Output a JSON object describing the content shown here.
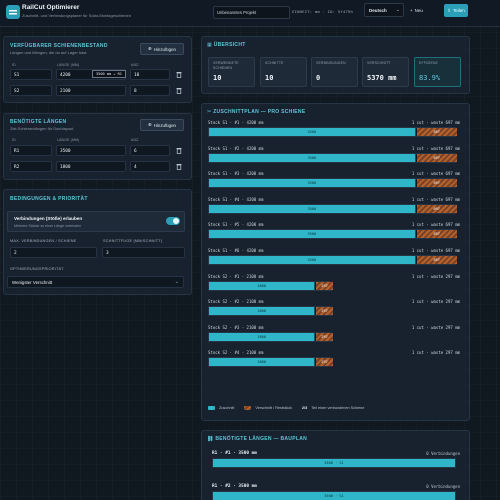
{
  "header": {
    "app_title": "RailCut Optimierer",
    "app_subtitle": "Zuschnitt- und Verbindungsplaner für Solar-Montageschienen",
    "project_name": "Unbenanntes Projekt",
    "unit_info": "EINHEIT: mm · ID: 5f479h",
    "language": "Deutsch",
    "new_label": "Neu",
    "share_label": "Teilen",
    "accent": "#2a9fb8"
  },
  "stock": {
    "title": "VERFÜGBARER SCHIENENBESTAND",
    "subtitle": "Längen und Mengen, die du auf Lager hast",
    "add_label": "Hinzufügen",
    "headers": [
      "ID",
      "LÄNGE (MM)",
      "ANZ."
    ],
    "rows": [
      {
        "id": "S1",
        "length": "4200",
        "qty": "10"
      },
      {
        "id": "S2",
        "length": "2100",
        "qty": "8"
      }
    ],
    "tooltip": "3500 mm → R1"
  },
  "required": {
    "title": "BENÖTIGTE LÄNGEN",
    "subtitle": "Ziel-Schienenlängen für Dachlayout",
    "add_label": "Hinzufügen",
    "headers": [
      "ID",
      "LÄNGE (MM)",
      "ANZ."
    ],
    "rows": [
      {
        "id": "R1",
        "length": "3500",
        "qty": "6"
      },
      {
        "id": "R2",
        "length": "1800",
        "qty": "4"
      }
    ]
  },
  "constraints": {
    "title": "BEDINGUNGEN & PRIORITÄT",
    "joins_label": "Verbindungen (Stöße) erlauben",
    "joins_sub": "Mehrere Stücke zu einer Länge verbinden",
    "joins_enabled": true,
    "max_joins_label": "MAX. VERBINDUNGEN / SCHIENE",
    "max_joins_value": "2",
    "kerf_label": "SCHNITTFUGE (MM/SCHNITT)",
    "kerf_value": "3",
    "priority_label": "OPTIMIERUNGSPRIORITÄT",
    "priority_value": "Wenigster Verschnitt"
  },
  "overview": {
    "title": "ÜBERSICHT",
    "stats": [
      {
        "label": "VERWENDETE SCHIENEN",
        "value": "10"
      },
      {
        "label": "SCHNITTE",
        "value": "10"
      },
      {
        "label": "VERBINDUNGEN",
        "value": "0"
      },
      {
        "label": "VERSCHNITT",
        "value": "5370 mm"
      },
      {
        "label": "EFFIZIENZ",
        "value": "83.9%"
      }
    ]
  },
  "cut_plan": {
    "title": "ZUSCHNITTPLAN — PRO SCHIENE",
    "rails": [
      {
        "label": "Stock S1 · #1 · 4200 mm",
        "waste_text": "1 cut · waste 697 mm",
        "stock": 4200,
        "cut": 3500,
        "waste": 697,
        "cut_label": "3500",
        "waste_label": "697"
      },
      {
        "label": "Stock S1 · #2 · 4200 mm",
        "waste_text": "1 cut · waste 697 mm",
        "stock": 4200,
        "cut": 3500,
        "waste": 697,
        "cut_label": "3500",
        "waste_label": "697"
      },
      {
        "label": "Stock S1 · #3 · 4200 mm",
        "waste_text": "1 cut · waste 697 mm",
        "stock": 4200,
        "cut": 3500,
        "waste": 697,
        "cut_label": "3500",
        "waste_label": "697"
      },
      {
        "label": "Stock S1 · #4 · 4200 mm",
        "waste_text": "1 cut · waste 697 mm",
        "stock": 4200,
        "cut": 3500,
        "waste": 697,
        "cut_label": "3500",
        "waste_label": "697"
      },
      {
        "label": "Stock S1 · #5 · 4200 mm",
        "waste_text": "1 cut · waste 697 mm",
        "stock": 4200,
        "cut": 3500,
        "waste": 697,
        "cut_label": "3500",
        "waste_label": "697"
      },
      {
        "label": "Stock S1 · #6 · 4200 mm",
        "waste_text": "1 cut · waste 697 mm",
        "stock": 4200,
        "cut": 3500,
        "waste": 697,
        "cut_label": "3500",
        "waste_label": "697"
      },
      {
        "label": "Stock S2 · #1 · 2100 mm",
        "waste_text": "1 cut · waste 297 mm",
        "stock": 2100,
        "cut": 1800,
        "waste": 297,
        "cut_label": "1800",
        "waste_label": "297"
      },
      {
        "label": "Stock S2 · #2 · 2100 mm",
        "waste_text": "1 cut · waste 297 mm",
        "stock": 2100,
        "cut": 1800,
        "waste": 297,
        "cut_label": "1800",
        "waste_label": "297"
      },
      {
        "label": "Stock S2 · #3 · 2100 mm",
        "waste_text": "1 cut · waste 297 mm",
        "stock": 2100,
        "cut": 1800,
        "waste": 297,
        "cut_label": "1800",
        "waste_label": "297"
      },
      {
        "label": "Stock S2 · #4 · 2100 mm",
        "waste_text": "1 cut · waste 297 mm",
        "stock": 2100,
        "cut": 1800,
        "waste": 297,
        "cut_label": "1800",
        "waste_label": "297"
      }
    ],
    "legend": {
      "cut": "Zuschnitt",
      "waste": "Verschnitt / Reststück",
      "joined_prefix": "2/3",
      "joined": "Teil einer verbundenen Schiene"
    },
    "max_stock": 4200
  },
  "build_plan": {
    "title": "BENÖTIGTE LÄNGEN — BAUPLAN",
    "rows": [
      {
        "label": "R1 · #1 · 3500 mm",
        "right": "0 Verbindungen",
        "segment": "3500 · S1"
      },
      {
        "label": "R1 · #2 · 3500 mm",
        "right": "0 Verbindungen",
        "segment": "3500 · S1"
      }
    ]
  }
}
